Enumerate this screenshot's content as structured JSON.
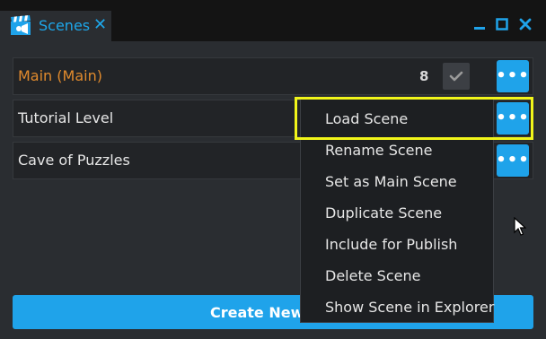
{
  "tab": {
    "title": "Scenes",
    "close_glyph": "✕",
    "icon": "clapperboard-icon"
  },
  "window_controls": [
    "minimize-icon",
    "maximize-icon",
    "close-icon"
  ],
  "scenes": [
    {
      "name": "Main (Main)",
      "is_main": true,
      "count": "8",
      "check_icon": "check-icon"
    },
    {
      "name": "Tutorial Level",
      "is_main": false
    },
    {
      "name": "Cave of Puzzles",
      "is_main": false
    }
  ],
  "more_button_glyph": "•••",
  "create_button": {
    "label": "Create New S"
  },
  "context_menu": {
    "items": [
      "Load Scene",
      "Rename Scene",
      "Set as Main Scene",
      "Duplicate Scene",
      "Include for Publish",
      "Delete Scene",
      "Show Scene in Explorer"
    ]
  },
  "colors": {
    "accent": "#1fa3ea",
    "main_scene_text": "#e08a2d",
    "highlight": "#f1f51a",
    "panel_bg": "#2a2d31"
  }
}
